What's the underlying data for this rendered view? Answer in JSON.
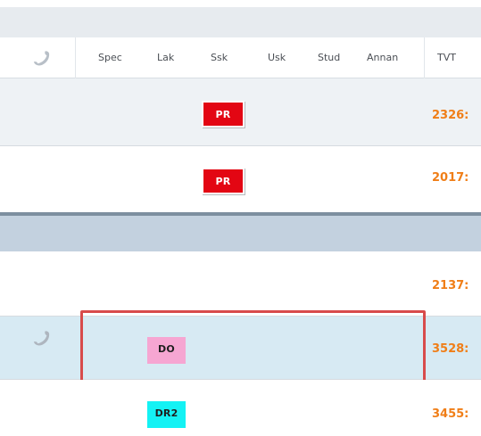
{
  "header": {
    "columns": {
      "spec": "Spec",
      "lak": "Lak",
      "ssk": "Ssk",
      "usk": "Usk",
      "stud": "Stud",
      "annan": "Annan",
      "tvt": "TVT"
    },
    "phone_icon": "phone-icon"
  },
  "rows": [
    {
      "badge": "PR",
      "badge_color": "#e30613",
      "tvt": "2326:"
    },
    {
      "badge": "PR",
      "badge_color": "#e30613",
      "tvt": "2017:"
    },
    {
      "badge": "",
      "tvt": "2137:"
    },
    {
      "badge": "DO",
      "badge_color": "#f6a6d2",
      "tvt": "3528:",
      "selected": true,
      "phone_icon": "phone-icon"
    },
    {
      "badge": "DR2",
      "badge_color": "#14f2f4",
      "tvt": "3455:"
    }
  ],
  "colors": {
    "tvt_text": "#f07e17",
    "highlight_border": "#d84b4b",
    "selected_row_bg": "#d7eaf3"
  }
}
